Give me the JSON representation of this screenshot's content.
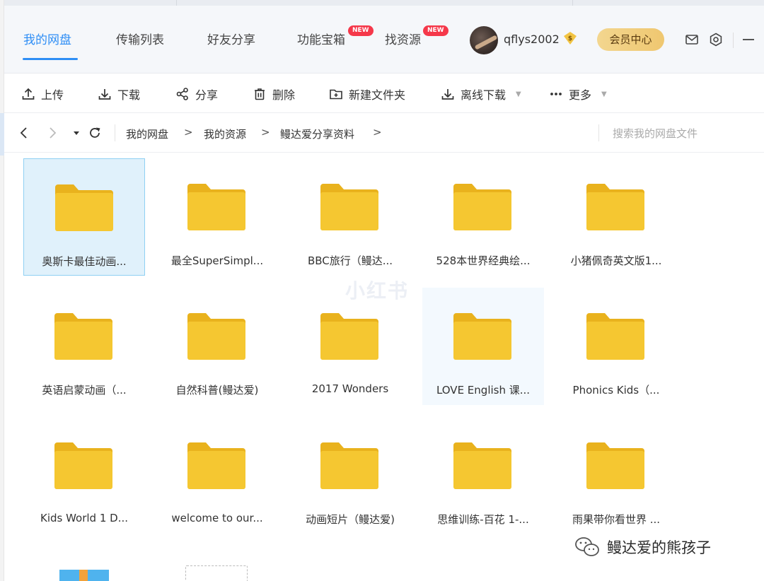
{
  "header": {
    "tabs": [
      {
        "label": "我的网盘",
        "active": true
      },
      {
        "label": "传输列表",
        "active": false
      },
      {
        "label": "好友分享",
        "active": false
      },
      {
        "label": "功能宝箱",
        "active": false,
        "badge": "NEW"
      },
      {
        "label": "找资源",
        "active": false,
        "badge": "NEW"
      }
    ],
    "username": "qflys2002",
    "vip_label": "会员中心",
    "accent_color": "#2f8ef5"
  },
  "toolbar": {
    "upload": "上传",
    "download": "下载",
    "share": "分享",
    "delete": "删除",
    "new_folder": "新建文件夹",
    "offline_download": "离线下载",
    "more": "更多"
  },
  "breadcrumb": {
    "items": [
      "我的网盘",
      "我的资源",
      "鳗达爱分享资料"
    ],
    "separator": ">"
  },
  "search": {
    "placeholder": "搜索我的网盘文件"
  },
  "folders": [
    {
      "name": "奥斯卡最佳动画...",
      "selected": true
    },
    {
      "name": "最全SuperSimpl..."
    },
    {
      "name": "BBC旅行（鳗达..."
    },
    {
      "name": "528本世界经典绘..."
    },
    {
      "name": "小猪佩奇英文版1..."
    },
    {
      "name": "英语启蒙动画（..."
    },
    {
      "name": "自然科普(鳗达爱)"
    },
    {
      "name": "2017 Wonders"
    },
    {
      "name": "LOVE English 课...",
      "hover": true
    },
    {
      "name": "Phonics Kids（..."
    },
    {
      "name": "Kids World 1 D..."
    },
    {
      "name": "welcome to our..."
    },
    {
      "name": "动画短片（鳗达爱)"
    },
    {
      "name": "思维训练-百花 1-..."
    },
    {
      "name": "雨果带你看世界 ..."
    }
  ],
  "watermark": "小红书",
  "wechat_account": "鳗达爱的熊孩子",
  "colors": {
    "folder": "#f5c731",
    "folder_tab": "#e9b21d",
    "selection_bg": "#e0f1fb",
    "vip_gold": "#f0cc7a",
    "badge_red": "#f5384a"
  }
}
